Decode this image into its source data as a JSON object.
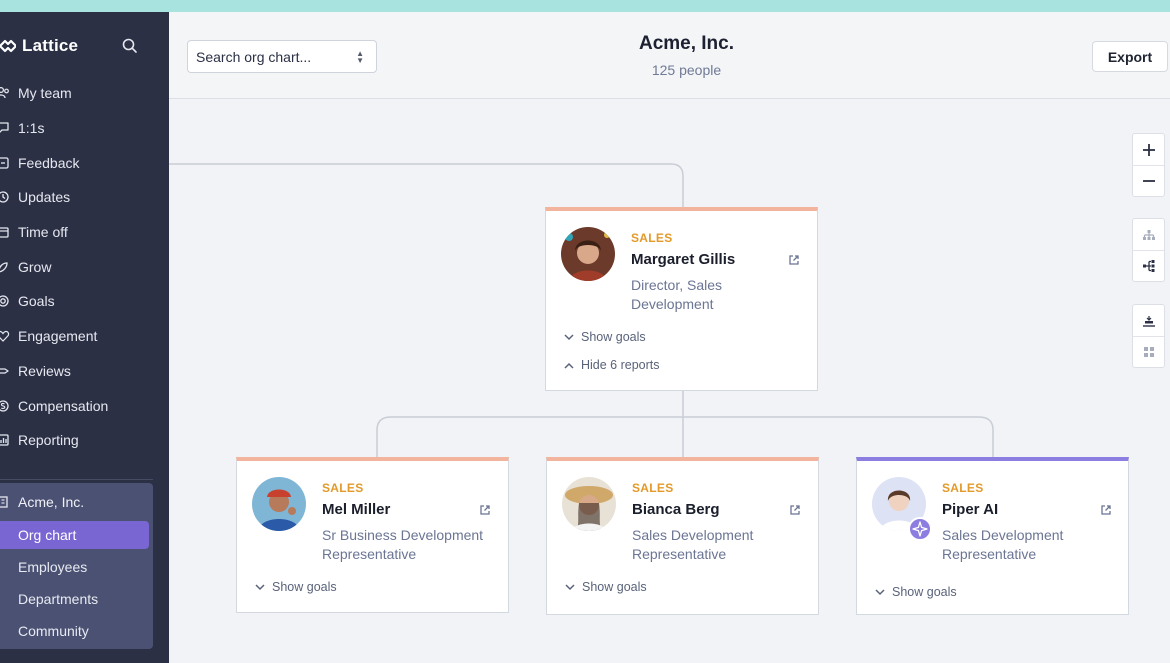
{
  "app": {
    "name": "Lattice"
  },
  "sidebar": {
    "items": [
      {
        "label": "My team",
        "icon": "team-icon"
      },
      {
        "label": "1:1s",
        "icon": "chat-icon"
      },
      {
        "label": "Feedback",
        "icon": "feedback-icon"
      },
      {
        "label": "Updates",
        "icon": "updates-icon"
      },
      {
        "label": "Time off",
        "icon": "calendar-icon"
      },
      {
        "label": "Grow",
        "icon": "grow-icon"
      },
      {
        "label": "Goals",
        "icon": "target-icon"
      },
      {
        "label": "Engagement",
        "icon": "heart-icon"
      },
      {
        "label": "Reviews",
        "icon": "reviews-icon"
      },
      {
        "label": "Compensation",
        "icon": "money-icon"
      },
      {
        "label": "Reporting",
        "icon": "chart-icon"
      }
    ],
    "company": {
      "label": "Acme, Inc.",
      "subitems": [
        "Org chart",
        "Employees",
        "Departments",
        "Community"
      ],
      "active": "Org chart"
    }
  },
  "header": {
    "search_placeholder": "Search org chart...",
    "title": "Acme, Inc.",
    "count": "125 people",
    "export_label": "Export"
  },
  "manager": {
    "dept": "SALES",
    "name": "Margaret Gillis",
    "title_line1": "Director, Sales",
    "title_line2": "Development",
    "show_goals": "Show goals",
    "hide_reports": "Hide 6 reports"
  },
  "reports": [
    {
      "dept": "SALES",
      "name": "Mel Miller",
      "title_line1": "Sr Business Development",
      "title_line2": "Representative",
      "show_goals": "Show goals"
    },
    {
      "dept": "SALES",
      "name": "Bianca Berg",
      "title_line1": "Sales Development",
      "title_line2": "Representative",
      "show_goals": "Show goals"
    },
    {
      "dept": "SALES",
      "name": "Piper AI",
      "title_line1": "Sales Development",
      "title_line2": "Representative",
      "show_goals": "Show goals"
    }
  ],
  "tools": [
    "zoom-in-icon",
    "zoom-out-icon",
    "hierarchy-vertical-icon",
    "hierarchy-horizontal-icon",
    "align-icon",
    "grid-icon"
  ],
  "colors": {
    "sidebar_bg": "#2b3044",
    "active_nav": "#7a66d3",
    "dept_label": "#e39a2a",
    "card_accent": "#f2b49c",
    "ai_accent": "#8c7ee0",
    "top_strip": "#a8e3df"
  }
}
